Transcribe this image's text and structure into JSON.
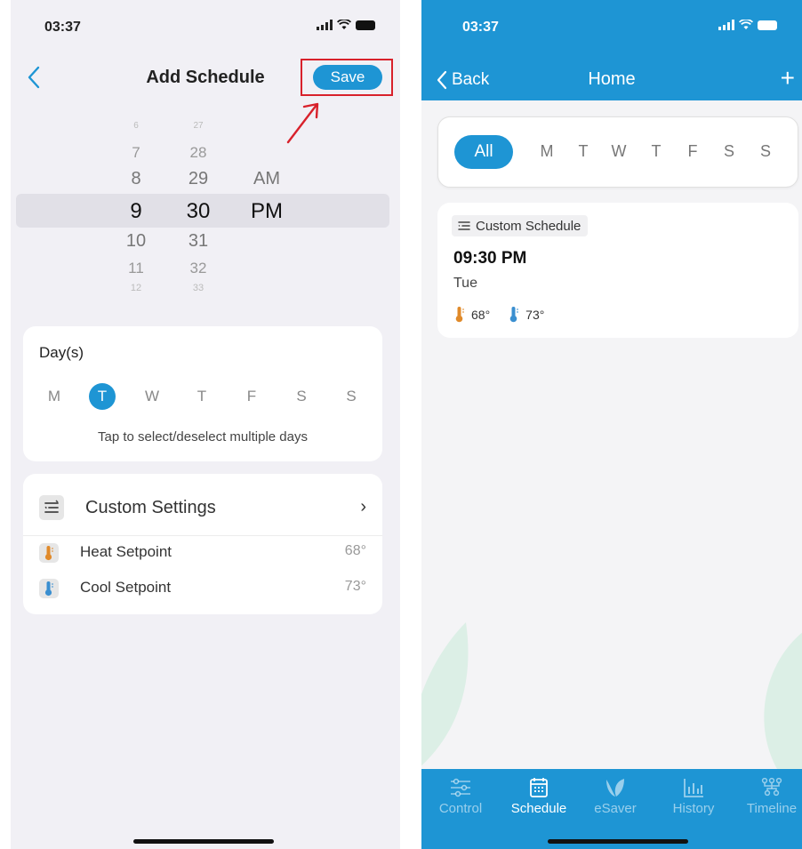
{
  "left": {
    "status_time": "03:37",
    "nav_title": "Add Schedule",
    "save_label": "Save",
    "picker": {
      "hours": [
        "6",
        "7",
        "8",
        "9",
        "10",
        "11",
        "12"
      ],
      "minutes": [
        "27",
        "28",
        "29",
        "30",
        "31",
        "32",
        "33"
      ],
      "ampm": [
        "AM",
        "PM"
      ],
      "selected": {
        "hour": "9",
        "minute": "30",
        "ampm": "PM"
      }
    },
    "days_card": {
      "title": "Day(s)",
      "days": [
        "M",
        "T",
        "W",
        "T",
        "F",
        "S",
        "S"
      ],
      "selected_index": 1,
      "hint": "Tap to select/deselect multiple days"
    },
    "settings_card": {
      "title": "Custom Settings",
      "chevron": "›",
      "heat_label": "Heat Setpoint",
      "heat_value": "68°",
      "cool_label": "Cool Setpoint",
      "cool_value": "73°"
    }
  },
  "right": {
    "status_time": "03:37",
    "back_label": "Back",
    "nav_title": "Home",
    "plus": "+",
    "filter": {
      "all_label": "All",
      "days": [
        "M",
        "T",
        "W",
        "T",
        "F",
        "S",
        "S"
      ]
    },
    "schedule": {
      "tag": "Custom Schedule",
      "time": "09:30 PM",
      "day": "Tue",
      "heat": "68°",
      "cool": "73°"
    },
    "tabs": [
      {
        "label": "Control",
        "icon": "sliders-icon"
      },
      {
        "label": "Schedule",
        "icon": "calendar-icon"
      },
      {
        "label": "eSaver",
        "icon": "leaf-icon"
      },
      {
        "label": "History",
        "icon": "bar-chart-icon"
      },
      {
        "label": "Timeline",
        "icon": "hierarchy-icon"
      }
    ],
    "active_tab": "Schedule"
  },
  "colors": {
    "accent": "#1e95d4",
    "annotation_red": "#d8212b",
    "heat": "#e08a2a",
    "cool": "#3a8fd0"
  }
}
